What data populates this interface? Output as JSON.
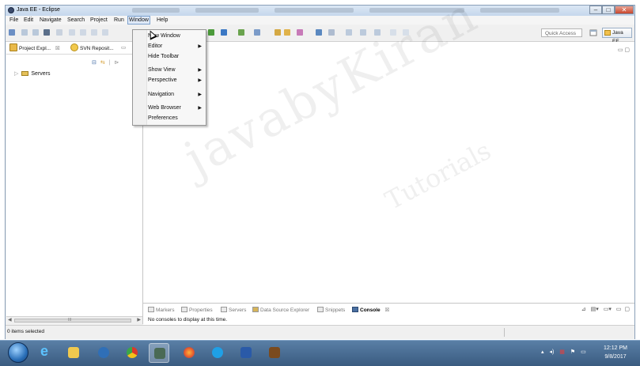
{
  "window": {
    "title": "Java EE - Eclipse"
  },
  "menubar": {
    "items": [
      {
        "label": "File"
      },
      {
        "label": "Edit"
      },
      {
        "label": "Navigate"
      },
      {
        "label": "Search"
      },
      {
        "label": "Project"
      },
      {
        "label": "Run"
      },
      {
        "label": "Window"
      },
      {
        "label": "Help"
      }
    ]
  },
  "toolbar": {
    "quick_access": "Quick Access",
    "perspective": "Java EE"
  },
  "left_panel": {
    "tabs": [
      {
        "label": "Project Expl...",
        "close": "☒"
      },
      {
        "label": "SVN Reposit..."
      }
    ],
    "tree": [
      {
        "label": "Servers"
      }
    ],
    "scroll_mid": "III"
  },
  "window_menu": {
    "items": [
      {
        "label": "New Window",
        "submenu": false
      },
      {
        "label": "Editor",
        "submenu": true
      },
      {
        "label": "Hide Toolbar",
        "submenu": false
      },
      {
        "label": "Show View",
        "submenu": true
      },
      {
        "label": "Perspective",
        "submenu": true
      },
      {
        "label": "Navigation",
        "submenu": true
      },
      {
        "label": "Web Browser",
        "submenu": true
      },
      {
        "label": "Preferences",
        "submenu": false
      }
    ]
  },
  "watermark": {
    "line1": "javabyKiran",
    "line2": "Tutorials"
  },
  "console_panel": {
    "tabs": [
      {
        "label": "Markers"
      },
      {
        "label": "Properties"
      },
      {
        "label": "Servers"
      },
      {
        "label": "Data Source Explorer"
      },
      {
        "label": "Snippets"
      },
      {
        "label": "Console"
      }
    ],
    "close": "☒",
    "message": "No consoles to display at this time."
  },
  "statusbar": {
    "message": "0 items selected"
  },
  "taskbar": {
    "time": "12:12 PM",
    "date": "9/8/2017"
  },
  "colors": {
    "accent": "#7da2ce",
    "taskbar": "#3a5b80"
  }
}
